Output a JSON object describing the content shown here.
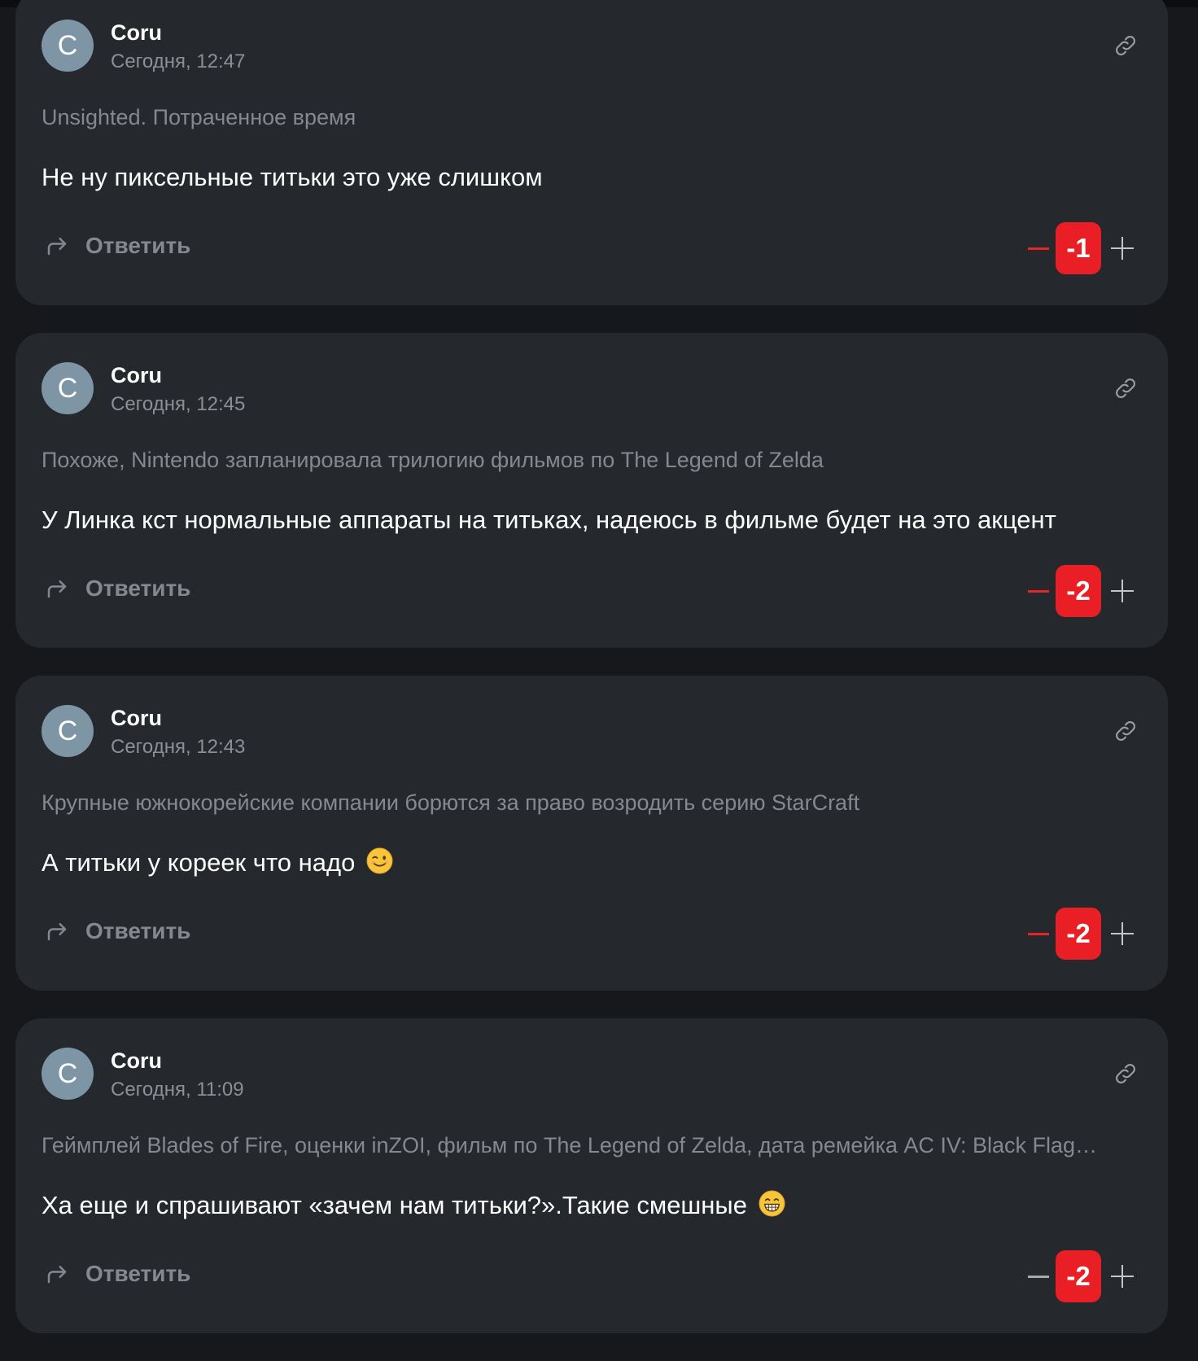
{
  "comments": [
    {
      "avatar_letter": "C",
      "author": "Coru",
      "time": "Сегодня, 12:47",
      "article": "Unsighted. Потраченное время",
      "text": "Не ну пиксельные титьки это уже слишком",
      "emoji": "",
      "reply_label": "Ответить",
      "score": "-1",
      "minus_state": "active"
    },
    {
      "avatar_letter": "C",
      "author": "Coru",
      "time": "Сегодня, 12:45",
      "article": "Похоже, Nintendo запланировала трилогию фильмов по The Legend of Zelda",
      "text": "У Линка кст нормальные аппараты на титьках, надеюсь в фильме будет на это акцент",
      "emoji": "",
      "reply_label": "Ответить",
      "score": "-2",
      "minus_state": "active"
    },
    {
      "avatar_letter": "C",
      "author": "Coru",
      "time": "Сегодня, 12:43",
      "article": "Крупные южнокорейские компании борются за право возродить серию StarCraft",
      "text": "А титьки у кореек что надо",
      "emoji": "wink-face-icon",
      "reply_label": "Ответить",
      "score": "-2",
      "minus_state": "active"
    },
    {
      "avatar_letter": "C",
      "author": "Coru",
      "time": "Сегодня, 11:09",
      "article": "Геймплей Blades of Fire, оценки inZOI, фильм по The Legend of Zelda, дата ремейка AC IV: Black Flag…",
      "text": "Ха еще и спрашивают «зачем нам титьки?».Такие смешные",
      "emoji": "grinning-face-icon",
      "reply_label": "Ответить",
      "score": "-2",
      "minus_state": "neutral"
    }
  ],
  "colors": {
    "background": "#16181b",
    "card": "#25282c",
    "avatar": "#7d95a4",
    "score_badge": "#ea1f25",
    "muted_text": "#85898f"
  }
}
